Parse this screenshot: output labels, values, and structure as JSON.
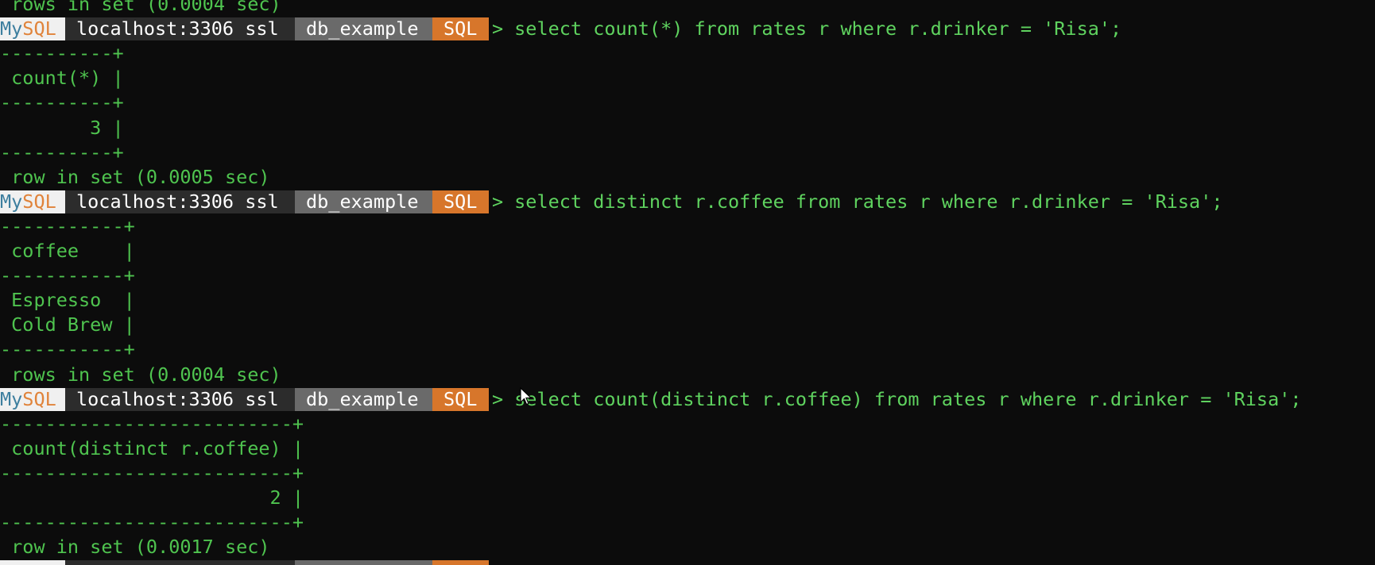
{
  "colors": {
    "background": "#0c0c0c",
    "output_text": "#4fc44f",
    "command_text": "#5fd35f",
    "mysql_segment_bg": "#f0f0f0",
    "host_segment_bg": "#2c2c2c",
    "db_segment_bg": "#6a6a6a",
    "mode_segment_bg": "#d7762b"
  },
  "prompt": {
    "app_my": "My",
    "app_sql": "SQL",
    "host": "localhost:3306 ssl",
    "database": "db_example",
    "mode": "SQL",
    "arrow": ">"
  },
  "lines": [
    {
      "type": "output",
      "text": " rows in set (0.0004 sec)"
    },
    {
      "type": "prompt",
      "command": "select count(*) from rates r where r.drinker = 'Risa';"
    },
    {
      "type": "output",
      "text": "----------+"
    },
    {
      "type": "output",
      "text": " count(*) |"
    },
    {
      "type": "output",
      "text": "----------+"
    },
    {
      "type": "output",
      "text": "        3 |"
    },
    {
      "type": "output",
      "text": "----------+"
    },
    {
      "type": "output",
      "text": " row in set (0.0005 sec)"
    },
    {
      "type": "prompt",
      "command": "select distinct r.coffee from rates r where r.drinker = 'Risa';"
    },
    {
      "type": "output",
      "text": "-----------+"
    },
    {
      "type": "output",
      "text": " coffee    |"
    },
    {
      "type": "output",
      "text": "-----------+"
    },
    {
      "type": "output",
      "text": " Espresso  |"
    },
    {
      "type": "output",
      "text": " Cold Brew |"
    },
    {
      "type": "output",
      "text": "-----------+"
    },
    {
      "type": "output",
      "text": " rows in set (0.0004 sec)"
    },
    {
      "type": "prompt",
      "command": "select count(distinct r.coffee) from rates r where r.drinker = 'Risa';"
    },
    {
      "type": "output",
      "text": "--------------------------+"
    },
    {
      "type": "output",
      "text": " count(distinct r.coffee) |"
    },
    {
      "type": "output",
      "text": "--------------------------+"
    },
    {
      "type": "output",
      "text": "                        2 |"
    },
    {
      "type": "output",
      "text": "--------------------------+"
    },
    {
      "type": "output",
      "text": " row in set (0.0017 sec)"
    }
  ],
  "icons": {
    "mouse_pointer": "arrow-cursor-icon"
  }
}
